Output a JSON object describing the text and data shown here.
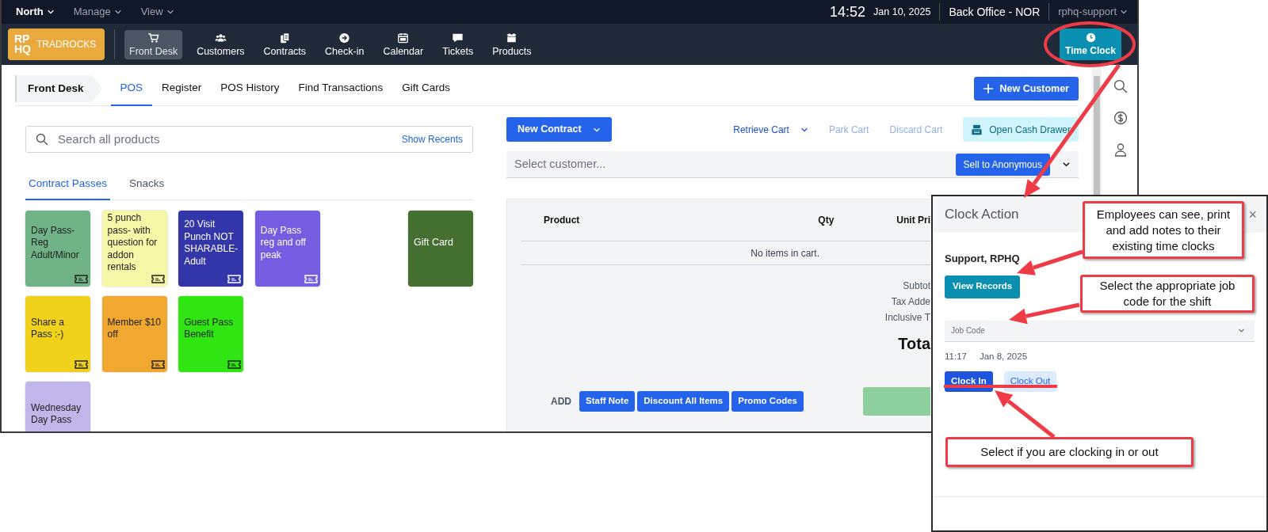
{
  "top_menu": [
    {
      "label": "North",
      "selected": true
    },
    {
      "label": "Manage",
      "selected": false
    },
    {
      "label": "View",
      "selected": false
    }
  ],
  "clock": {
    "time": "14:52",
    "date": "Jan 10, 2025"
  },
  "location": "Back Office - NOR",
  "user": "rphq-support",
  "logo": {
    "mark_top": "RP",
    "mark_bottom": "HQ",
    "name": "TRADROCKS"
  },
  "nav_items": [
    {
      "label": "Front Desk",
      "selected": true
    },
    {
      "label": "Customers",
      "selected": false
    },
    {
      "label": "Contracts",
      "selected": false
    },
    {
      "label": "Check-in",
      "selected": false
    },
    {
      "label": "Calendar",
      "selected": false
    },
    {
      "label": "Tickets",
      "selected": false
    },
    {
      "label": "Products",
      "selected": false
    }
  ],
  "time_clock_button": "Time Clock",
  "breadcrumb": "Front Desk",
  "tabs": [
    {
      "label": "POS",
      "selected": true
    },
    {
      "label": "Register",
      "selected": false
    },
    {
      "label": "POS History",
      "selected": false
    },
    {
      "label": "Find Transactions",
      "selected": false
    },
    {
      "label": "Gift Cards",
      "selected": false
    }
  ],
  "new_customer_button": "New Customer",
  "search": {
    "placeholder": "Search all products",
    "link": "Show Recents"
  },
  "categories": [
    {
      "label": "Contract Passes",
      "selected": true
    },
    {
      "label": "Snacks",
      "selected": false
    }
  ],
  "product_rows": [
    [
      {
        "kind": "pass",
        "label": "Day Pass-Reg Adult/Minor",
        "color": "#6fb386"
      },
      {
        "kind": "pass",
        "label": "5 punch pass- with question for addon rentals",
        "color": "#f7f7a8"
      },
      {
        "kind": "pass",
        "label": "20 Visit Punch NOT SHARABLE-Adult",
        "color": "#3336a8"
      },
      {
        "kind": "pass",
        "label": "Day Pass reg and off peak",
        "color": "#745de0"
      },
      {
        "kind": "gift_card",
        "label": "Gift Card",
        "color": "#436f30"
      }
    ],
    [
      {
        "kind": "pass",
        "label": "Share a Pass :-)",
        "color": "#f0d21c"
      },
      {
        "kind": "pass",
        "label": "Member $10 off",
        "color": "#f0a830"
      },
      {
        "kind": "pass",
        "label": "Guest Pass Benefit",
        "color": "#30e612"
      }
    ],
    [
      {
        "kind": "plain",
        "label": "Wednesday Day Pass",
        "color": "#c1b6ea"
      }
    ]
  ],
  "cart_toolbar": {
    "new_contract": "New Contract",
    "actions": [
      {
        "kind": "dropdown",
        "label": "Retrieve Cart",
        "disabled": false
      },
      {
        "kind": "link",
        "label": "Park Cart",
        "disabled": true
      },
      {
        "kind": "link",
        "label": "Discard Cart",
        "disabled": true
      },
      {
        "kind": "cash",
        "label": "Open Cash Drawer",
        "disabled": false
      }
    ]
  },
  "customer": {
    "placeholder": "Select customer...",
    "button": "Sell to Anonymous"
  },
  "cart": {
    "columns": [
      "Product",
      "Qty",
      "Unit Pri"
    ],
    "empty_text": "No items in cart.",
    "totals": [
      "Subtot",
      "Tax Adde",
      "Inclusive T"
    ],
    "total_label": "Tota",
    "add_label": "ADD",
    "add_buttons": [
      "Staff Note",
      "Discount All Items",
      "Promo Codes"
    ]
  },
  "clock_panel": {
    "title": "Clock Action",
    "close": "×",
    "employee": "Support, RPHQ",
    "view_records": "View Records",
    "job_code_placeholder": "Job Code",
    "time": "11:17",
    "date": "Jan 8, 2025",
    "actions": [
      {
        "label": "Clock In",
        "selected": true
      },
      {
        "label": "Clock Out",
        "selected": false
      }
    ]
  },
  "annotations": [
    "Employees can see, print and add notes to their existing time clocks",
    "Select the appropriate job code for the shift",
    "Select if you are clocking in or out"
  ]
}
